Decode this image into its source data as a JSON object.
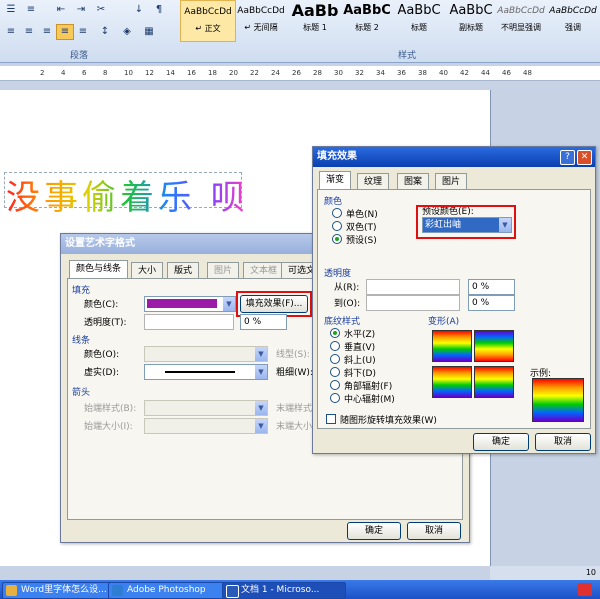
{
  "ribbon": {
    "paragraph_group": "段落",
    "styles_group": "样式",
    "styles": [
      {
        "preview": "AaBbCcDd",
        "name": "↵ 正文"
      },
      {
        "preview": "AaBbCcDd",
        "name": "↵ 无间隔"
      },
      {
        "preview": "AaBb",
        "name": "标题 1"
      },
      {
        "preview": "AaBbC",
        "name": "标题 2"
      },
      {
        "preview": "AaBbC",
        "name": "标题"
      },
      {
        "preview": "AaBbC",
        "name": "副标题"
      },
      {
        "preview": "AaBbCcDd",
        "name": "不明显强调"
      },
      {
        "preview": "AaBbCcDd",
        "name": "强调"
      }
    ]
  },
  "ruler": {
    "ticks": [
      "2",
      "4",
      "6",
      "8",
      "10",
      "12",
      "14",
      "16",
      "18",
      "20",
      "22",
      "24",
      "26",
      "28",
      "30",
      "32",
      "34",
      "36",
      "38",
      "40",
      "42",
      "44",
      "46",
      "48"
    ]
  },
  "document": {
    "wordart_text": "没事偷着乐 呗"
  },
  "wordart_dialog": {
    "title": "设置艺术字格式",
    "tabs": [
      "颜色与线条",
      "大小",
      "版式",
      "图片",
      "文本框",
      "可选文"
    ],
    "fill_section": "填充",
    "color_label": "颜色(C):",
    "fill_effects_button": "填充效果(F)...",
    "transparency_label": "透明度(T):",
    "transparency_value": "0 %",
    "line_section": "线条",
    "line_color_label": "颜色(O):",
    "dash_label": "虚实(D):",
    "line_style_label": "线型(S):",
    "weight_label": "粗细(W):",
    "arrows_section": "箭头",
    "begin_style_label": "始端样式(B):",
    "end_style_label": "末端样式(E):",
    "begin_size_label": "始端大小(I):",
    "end_size_label": "末端大小(Z):",
    "ok": "确定",
    "cancel": "取消"
  },
  "fill_dialog": {
    "title": "填充效果",
    "tabs": [
      "渐变",
      "纹理",
      "图案",
      "图片"
    ],
    "colors_section": "颜色",
    "radio_one": "单色(N)",
    "radio_two": "双色(T)",
    "radio_preset": "预设(S)",
    "preset_label": "预设颜色(E):",
    "preset_value": "彩虹出岫",
    "transparency_section": "透明度",
    "from_label": "从(R):",
    "to_label": "到(O):",
    "from_value": "0 %",
    "to_value": "0 %",
    "shading_section": "底纹样式",
    "shading": [
      "水平(Z)",
      "垂直(V)",
      "斜上(U)",
      "斜下(D)",
      "角部辐射(F)",
      "中心辐射(M)"
    ],
    "variants_section": "变形(A)",
    "sample_label": "示例:",
    "rotate_label": "随图形旋转填充效果(W)",
    "ok": "确定",
    "cancel": "取消"
  },
  "statusbar": {
    "zoom": "10"
  },
  "taskbar": {
    "items": [
      "Word里字体怎么设...",
      "Adobe Photoshop",
      "文档 1 - Microso..."
    ]
  },
  "colors": {
    "wordart_fill": "#9b1aa8",
    "dialog_bg": "#ece9d8",
    "highlight_red": "#e01010"
  }
}
